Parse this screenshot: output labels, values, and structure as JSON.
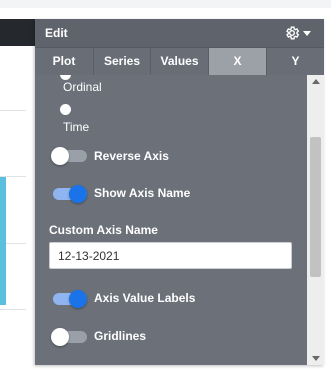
{
  "panel": {
    "title": "Edit",
    "settings_icon": "gear-icon",
    "menu_caret_icon": "caret-down-icon"
  },
  "tabs": [
    {
      "label": "Plot",
      "active": false
    },
    {
      "label": "Series",
      "active": false
    },
    {
      "label": "Values",
      "active": false
    },
    {
      "label": "X",
      "active": true
    },
    {
      "label": "Y",
      "active": false
    }
  ],
  "axis_type": {
    "options": [
      "Ordinal",
      "Time"
    ],
    "selected": "Time"
  },
  "toggles": {
    "reverse_axis": {
      "label": "Reverse Axis",
      "on": false
    },
    "show_axis_name": {
      "label": "Show Axis Name",
      "on": true
    },
    "axis_value_labels": {
      "label": "Axis Value Labels",
      "on": true
    },
    "gridlines": {
      "label": "Gridlines",
      "on": false
    }
  },
  "custom_axis_name": {
    "label": "Custom Axis Name",
    "value": "12-13-2021"
  },
  "colors": {
    "panel_bg": "#6b7079",
    "active_tab": "#9ca1a8",
    "toggle_on": "#1a73e8"
  }
}
